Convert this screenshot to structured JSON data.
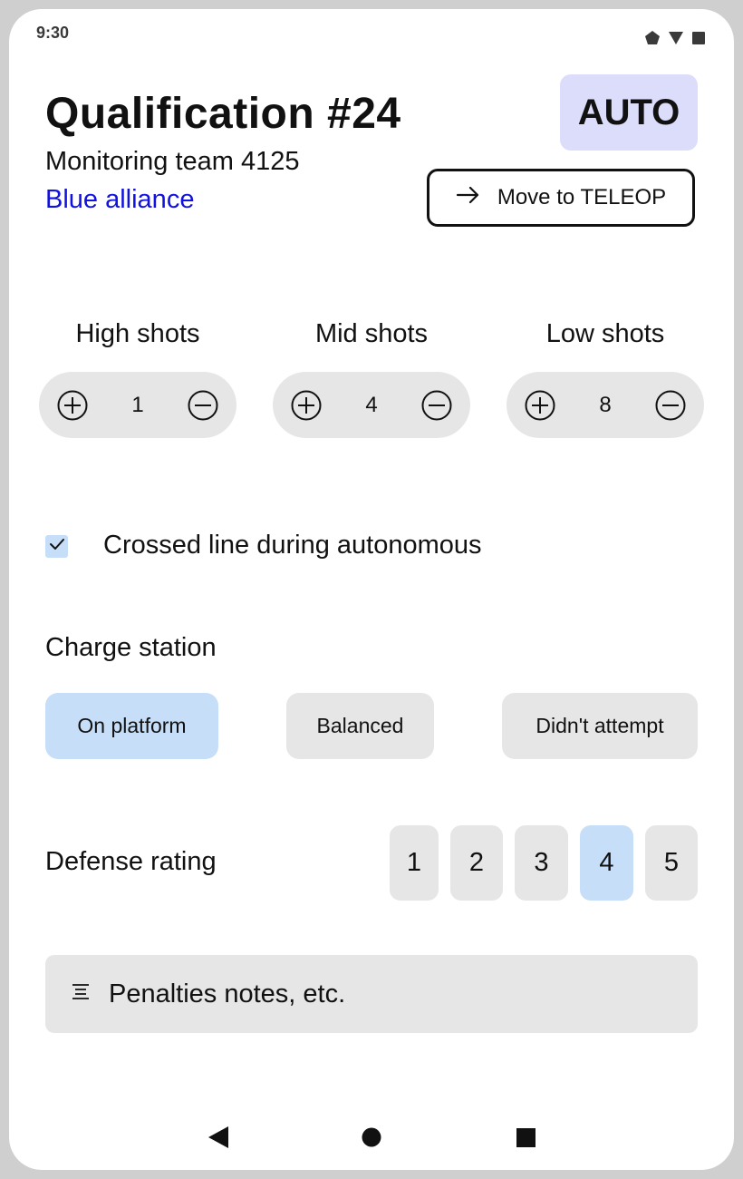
{
  "status_bar": {
    "time": "9:30",
    "icons": [
      "signal-pentagon-icon",
      "wifi-triangle-icon",
      "battery-square-icon"
    ]
  },
  "header": {
    "title": "Qualification #24",
    "subtitle": "Monitoring team 4125",
    "alliance": "Blue alliance",
    "mode": "AUTO",
    "move_button_label": "Move to TELEOP"
  },
  "shots": [
    {
      "label": "High shots",
      "value": "1"
    },
    {
      "label": "Mid shots",
      "value": "4"
    },
    {
      "label": "Low shots",
      "value": "8"
    }
  ],
  "crossed_line": {
    "label": "Crossed line during autonomous",
    "checked": true
  },
  "charge_station": {
    "title": "Charge station",
    "options": [
      "On platform",
      "Balanced",
      "Didn't attempt"
    ],
    "selected": "On platform"
  },
  "defense": {
    "label": "Defense rating",
    "options": [
      "1",
      "2",
      "3",
      "4",
      "5"
    ],
    "selected": "4"
  },
  "notes": {
    "placeholder": "Penalties notes, etc."
  },
  "colors": {
    "accent_selected": "#c6def8",
    "mode_badge": "#dcdcfb",
    "alliance_text": "#1212e0",
    "surface": "#e6e6e6"
  },
  "nav_bar": {
    "icons": [
      "back-icon",
      "home-icon",
      "recents-icon"
    ]
  }
}
